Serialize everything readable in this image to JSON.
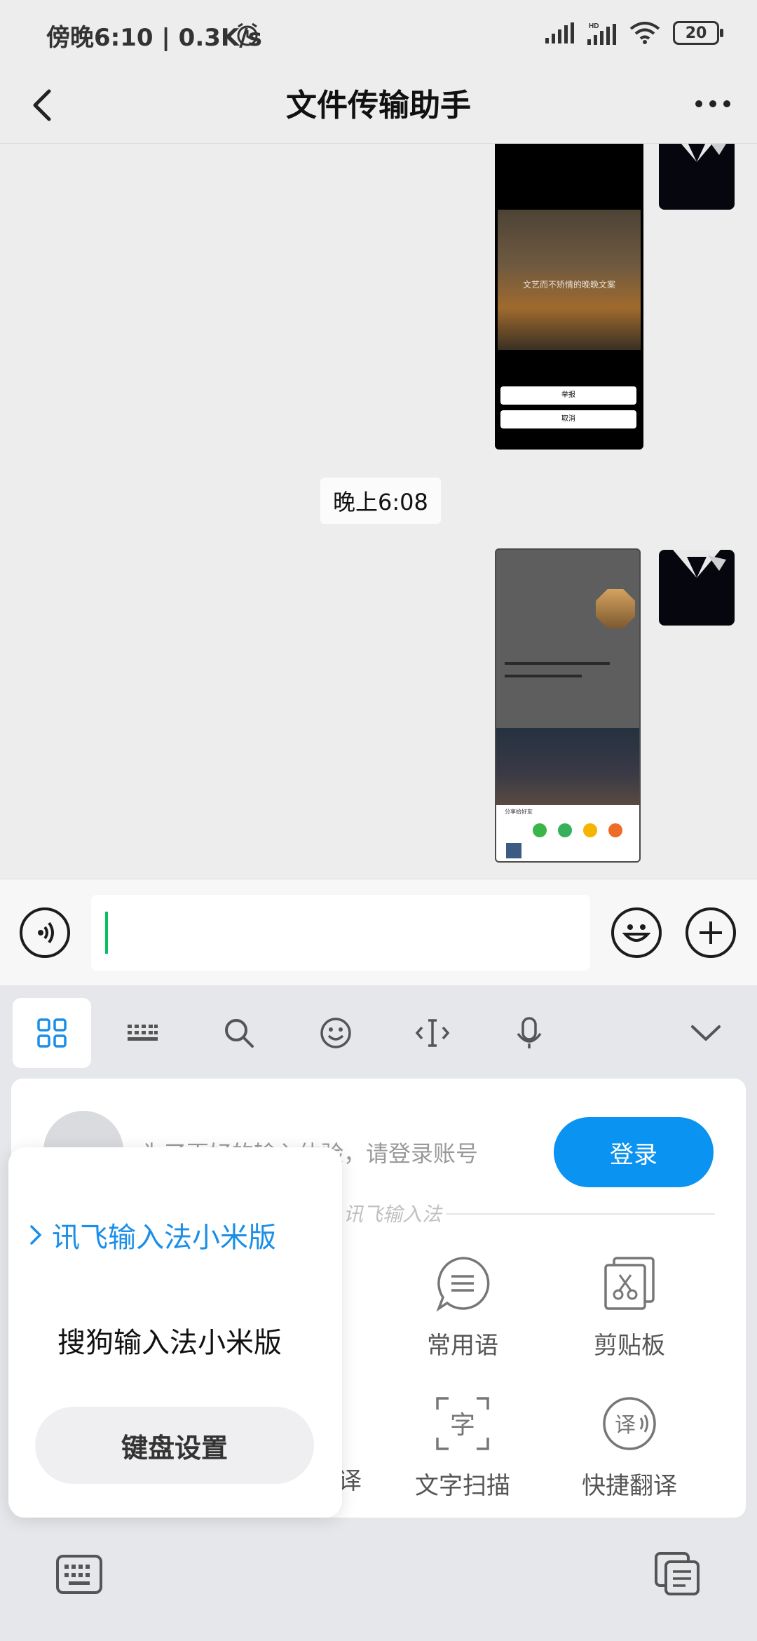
{
  "status_bar": {
    "time_text": "傍晚6:10 | 0.3K/s",
    "battery": "20",
    "icons": [
      "alarm-icon",
      "signal-icon",
      "hd-signal-icon",
      "wifi-icon",
      "battery-icon"
    ]
  },
  "nav": {
    "title": "文件传输助手",
    "back_icon": "chevron-left-icon",
    "more_icon": "more-dots-icon"
  },
  "chat": {
    "timestamp": "晚上6:08",
    "messages": [
      {
        "type": "image",
        "sender": "self",
        "screenshot_caption": "文艺而不矫情的晚晚文案",
        "buttons": [
          "举报",
          "取消"
        ]
      },
      {
        "type": "image",
        "sender": "self",
        "share_sheet_title": "分享给好友"
      }
    ]
  },
  "input_bar": {
    "voice_icon": "voice-icon",
    "emoji_icon": "emoji-icon",
    "plus_icon": "plus-icon",
    "text_value": ""
  },
  "keyboard": {
    "toolbar_icons": [
      "grid-icon",
      "keyboard-layout-icon",
      "search-icon",
      "emoji-icon",
      "cursor-icon",
      "microphone-icon",
      "collapse-chevron-icon"
    ],
    "login_prompt": "为了更好的输入体验，请登录账号",
    "login_button": "登录",
    "brand_label": "讯飞输入法",
    "features": [
      {
        "label": "常用语",
        "icon": "phrase-icon"
      },
      {
        "label": "剪贴板",
        "icon": "clipboard-icon"
      },
      {
        "label": "译",
        "icon": "translate-icon"
      },
      {
        "label": "文字扫描",
        "icon": "text-scan-icon"
      },
      {
        "label": "快捷翻译",
        "icon": "quick-translate-icon"
      }
    ],
    "bottom_left_icon": "keyboard-icon",
    "bottom_right_icon": "copy-icon"
  },
  "ime_menu": {
    "options": [
      {
        "label": "讯飞输入法小米版",
        "selected": true
      },
      {
        "label": "搜狗输入法小米版",
        "selected": false
      }
    ],
    "settings_button": "键盘设置"
  },
  "colors": {
    "accent_blue": "#0a93f0",
    "caret_green": "#07c160",
    "selected_text": "#1a8ee8"
  }
}
